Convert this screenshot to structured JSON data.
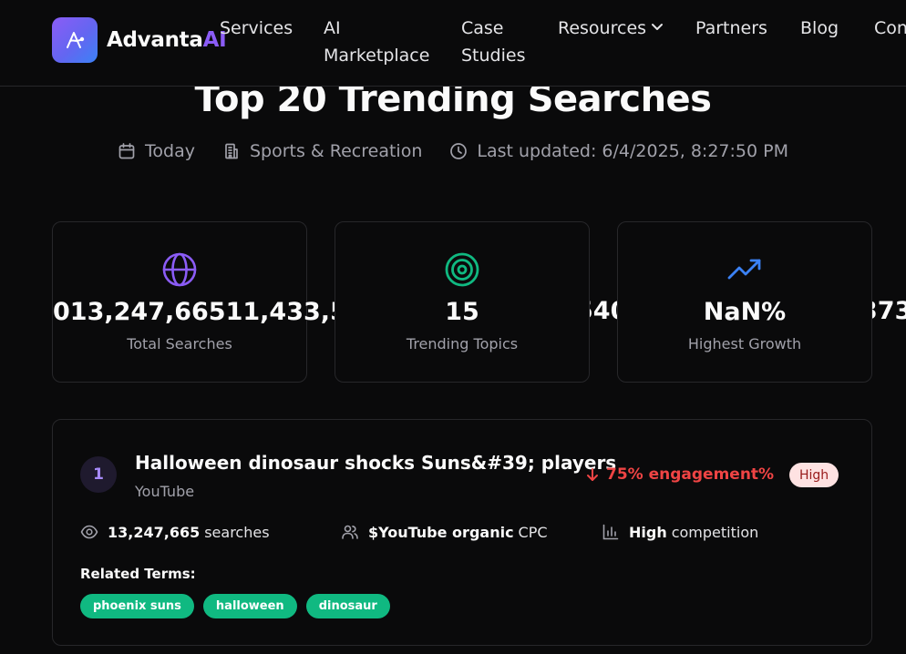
{
  "brand": {
    "name": "Advanta",
    "suffix": "AI"
  },
  "nav": [
    {
      "label": "Services",
      "lines": [
        "Services"
      ]
    },
    {
      "label": "AI Marketplace",
      "lines": [
        "AI",
        "Marketplace"
      ]
    },
    {
      "label": "Case Studies",
      "lines": [
        "Case",
        "Studies"
      ]
    },
    {
      "label": "Resources",
      "lines": [
        "Resources"
      ]
    },
    {
      "label": "Partners",
      "lines": [
        "Partners"
      ]
    },
    {
      "label": "Blog",
      "lines": [
        "Blog"
      ]
    },
    {
      "label": "Con",
      "lines": [
        "Con"
      ]
    }
  ],
  "page": {
    "title": "Top 20 Trending Searches",
    "date_filter": "Today",
    "category": "Sports & Recreation",
    "last_updated": "Last updated: 6/4/2025, 8:27:50 PM"
  },
  "stats": [
    {
      "value": "013,247,66511,433,5",
      "label": "Total Searches",
      "icon": "globe-icon"
    },
    {
      "value": "15",
      "label": "Trending Topics",
      "icon": "target-icon"
    },
    {
      "value": "NaN%",
      "label": "Highest Growth",
      "icon": "trending-up-icon"
    }
  ],
  "overflow_fragments": [
    "540",
    "373"
  ],
  "trends": [
    {
      "rank": "1",
      "title": "Halloween dinosaur shocks Suns&#39; players",
      "source": "YouTube",
      "engagement": "75% engagement%",
      "level": "High",
      "searches_value": "13,247,665",
      "searches_suffix": "searches",
      "cpc_value": "$YouTube organic",
      "cpc_suffix": "CPC",
      "competition_value": "High",
      "competition_suffix": "competition",
      "related_label": "Related Terms:",
      "related_terms": [
        "phoenix suns",
        "halloween",
        "dinosaur"
      ]
    }
  ],
  "colors": {
    "background": "#0a0a0b",
    "accent_purple": "#8b5cf6",
    "accent_green": "#10b981",
    "accent_blue": "#3b82f6",
    "negative_red": "#ef4444"
  }
}
